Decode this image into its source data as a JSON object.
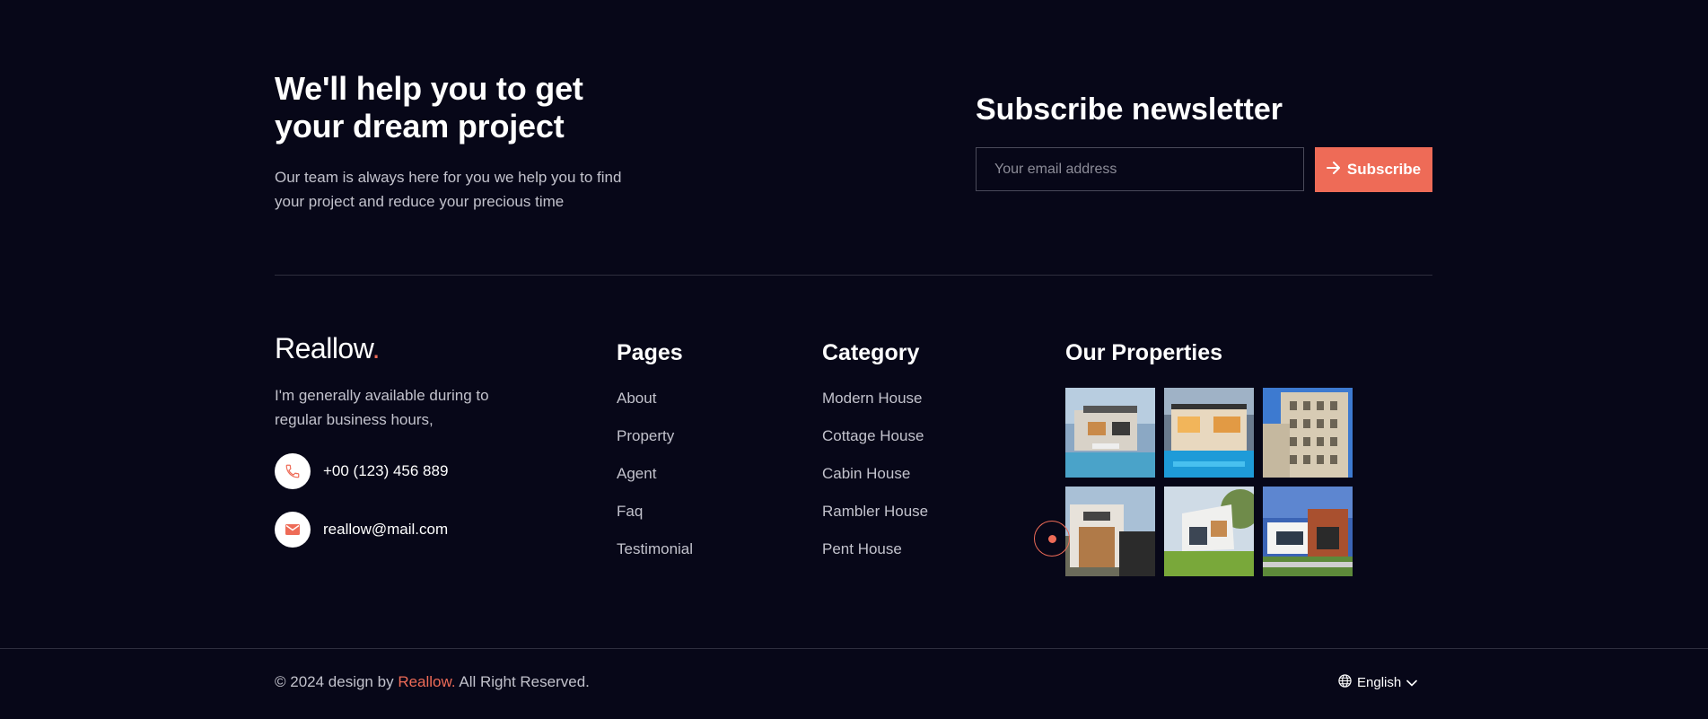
{
  "cta": {
    "title": "We'll help you to get your dream project",
    "text": "Our team is always here for you we help you to find your project and reduce your precious time"
  },
  "newsletter": {
    "title": "Subscribe newsletter",
    "placeholder": "Your email address",
    "button_label": "Subscribe",
    "button_icon": "arrow-right-icon"
  },
  "brand": {
    "name": "Reallow",
    "dot": ".",
    "about": "I'm generally available during to regular business hours,",
    "phone": "+00 (123) 456 889",
    "email": "reallow@mail.com"
  },
  "pages": {
    "title": "Pages",
    "items": [
      "About",
      "Property",
      "Agent",
      "Faq",
      "Testimonial"
    ]
  },
  "category": {
    "title": "Category",
    "items": [
      "Modern House",
      "Cottage House",
      "Cabin House",
      "Rambler House",
      "Pent House"
    ]
  },
  "properties": {
    "title": "Our Properties",
    "images": [
      "modern-house-pool-photo",
      "villa-pool-night-photo",
      "apartment-building-photo",
      "wooden-modern-house-photo",
      "white-house-lawn-photo",
      "house-blue-sky-photo"
    ]
  },
  "footer": {
    "copyright_prefix": "© 2024 design by",
    "copyright_brand": "Reallow.",
    "copyright_suffix": "All Right Reserved.",
    "language": "English"
  },
  "colors": {
    "background": "#070718",
    "accent": "#ee6b57"
  }
}
